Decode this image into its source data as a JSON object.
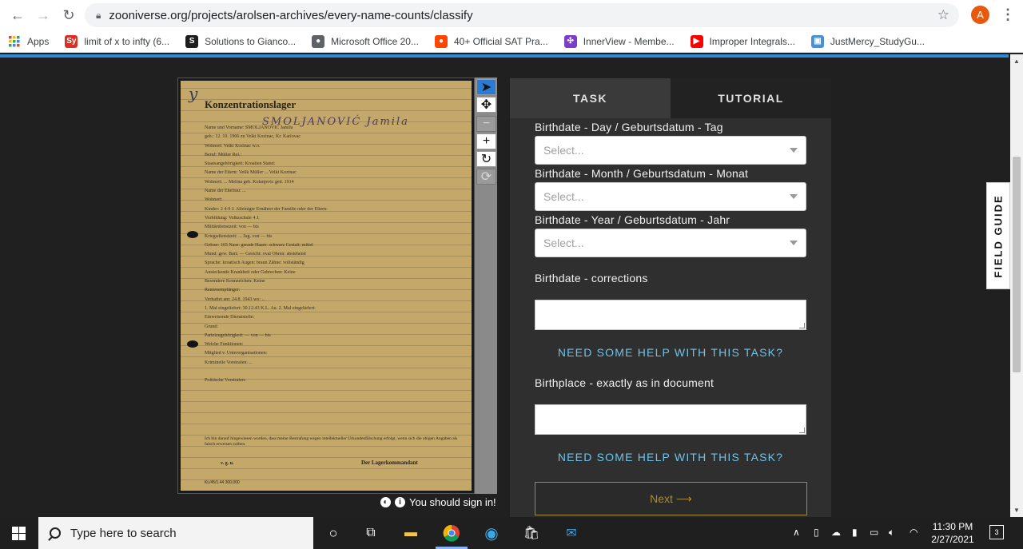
{
  "browser": {
    "url": "zooniverse.org/projects/arolsen-archives/every-name-counts/classify",
    "avatar_letter": "A",
    "bookmarks": [
      {
        "label": "Apps",
        "icon": "apps-grid-icon",
        "color": "#ea4335"
      },
      {
        "label": "limit of x to infty (6...",
        "icon": "symbolab-icon",
        "color": "#d93025",
        "icon_text": "Sy"
      },
      {
        "label": "Solutions to Gianco...",
        "icon": "slader-icon",
        "color": "#1e1e1e",
        "icon_text": "S"
      },
      {
        "label": "Microsoft Office 20...",
        "icon": "globe-icon",
        "color": "#5f6368",
        "icon_text": "●"
      },
      {
        "label": "40+ Official SAT Pra...",
        "icon": "reddit-icon",
        "color": "#ff4500",
        "icon_text": "●"
      },
      {
        "label": "InnerView - Membe...",
        "icon": "innerview-icon",
        "color": "#7b3fc7",
        "icon_text": "✣"
      },
      {
        "label": "Improper Integrals...",
        "icon": "youtube-icon",
        "color": "#ff0000",
        "icon_text": "▶"
      },
      {
        "label": "JustMercy_StudyGu...",
        "icon": "document-icon",
        "color": "#4a90d9",
        "icon_text": "▣"
      }
    ]
  },
  "document": {
    "title": "Konzentrationslager",
    "handwritten_name": "SMOLJANOVIĆ  Jamila",
    "fields": [
      "Name und Vorname:  SMOLJANOVIĆ Jamila",
      "geb.: 12. 10. 1906 zu Velki Kozinac, Kr. Karlovac",
      "Wohnort: Velki Kozinac w.o.",
      "Beruf: Müller                                   Rel.:",
      "Staatsangehörigkeit: Kroatien                   Stand:",
      "Name der Eltern: Vellk Müller ... Velki Kozinac",
      "Wohnort: ... Melina geb. Kolanjevic ged. 1914",
      "Name der Ehefrau: ...",
      "Wohnort:",
      "Kinder: 2   4-9 J.  Alleiniger Ernährer der Familie oder der Eltern:",
      "Vorbildung: Volksschule 4 J.",
      "Militärdienstzeit:                         von — bis",
      "Kriegsdienstzeit: ... Jug.                 von — bis",
      "Grösse: 165     Nase: gerade    Haare: schwarz    Gestalt: mittel",
      "Mund: gew.      Bart: —         Gesicht: oval     Ohren: abstehend",
      "Sprache: kroatisch              Augen: braun      Zähne: vollständig",
      "Ansteckende Krankheit oder Gebrechen: Keine",
      "Besondere Kennzeichen: Keine",
      "Rentenempfänger:",
      "Verhaftet am: 24.8. 1943  wo: ...",
      "1. Mal eingeliefert: 30.12.43  K.L. Au.   2. Mal eingeliefert:",
      "Einweisende Dienststelle:",
      "Grund:",
      "Parteizugehörigkeit: —                  von — bis",
      "Welche Funktionen:",
      "Mitglied v. Unterorganisationen:",
      "Kriminelle Vorstrafen: ...",
      "",
      "Politische Vorstrafen:"
    ],
    "footer_text": "Ich bin darauf hingewiesen worden, dass meine Bestrafung wegen intellektueller Urkundenfälschung erfolgt, wenn sich die obigen Angaben als falsch erweisen sollten.",
    "footer_sign": "v. g. u.",
    "commandant": "Der Lagerkommandant",
    "form_code": "KL/45/1.44 300.000"
  },
  "viewer": {
    "signin_text": "You should sign in!"
  },
  "panel": {
    "tabs": [
      "TASK",
      "TUTORIAL"
    ],
    "q_day": "Birthdate - Day / Geburtsdatum - Tag",
    "q_month": "Birthdate - Month / Geburtsdatum - Monat",
    "q_year": "Birthdate - Year / Geburtsdatum - Jahr",
    "select_placeholder": "Select...",
    "q_corrections": "Birthdate - corrections",
    "help_text": "NEED SOME HELP WITH THIS TASK?",
    "q_birthplace": "Birthplace - exactly as in document",
    "next_label": "Next ⟶",
    "field_guide": "FIELD GUIDE"
  },
  "taskbar": {
    "search_placeholder": "Type here to search",
    "time": "11:30 PM",
    "date": "2/27/2021",
    "notifications": "3"
  }
}
